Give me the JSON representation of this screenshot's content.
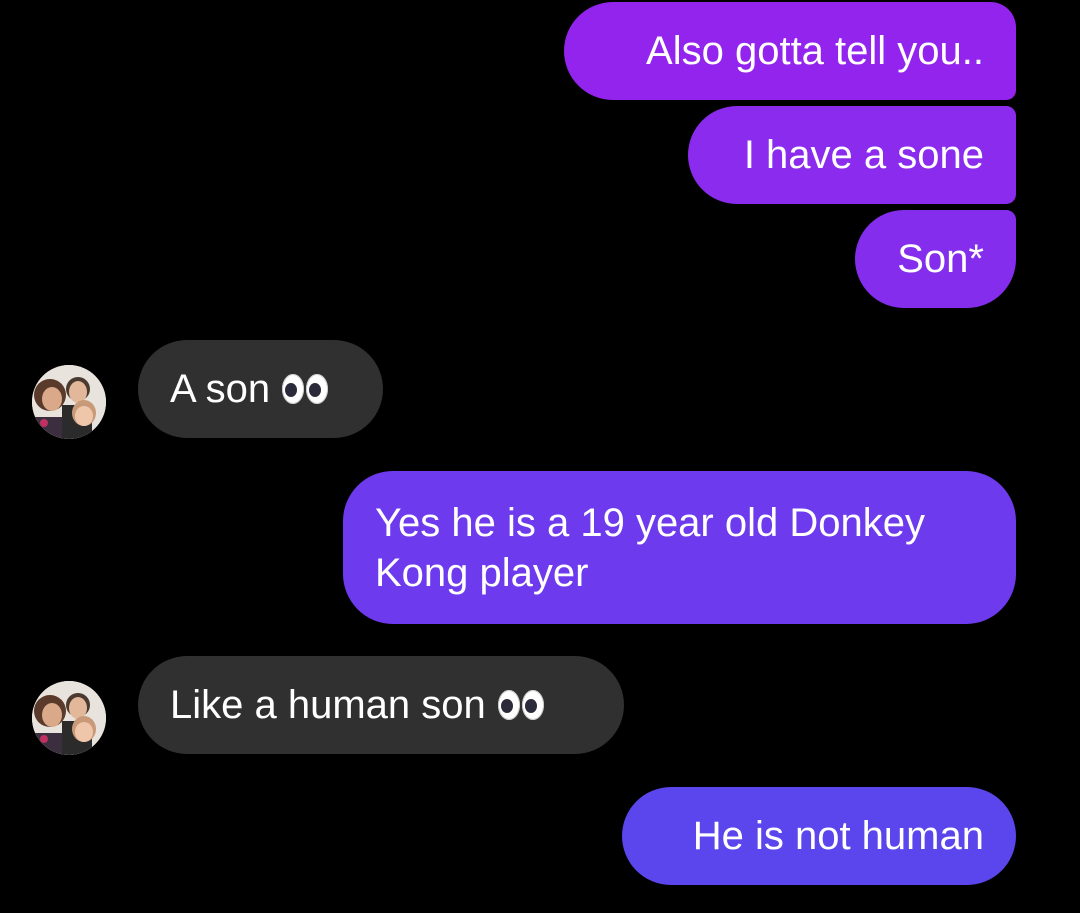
{
  "conversation": {
    "messages": [
      {
        "from": "me",
        "text": "Also gotta tell you.."
      },
      {
        "from": "me",
        "text": "I have a sone"
      },
      {
        "from": "me",
        "text": "Son*"
      },
      {
        "from": "them",
        "text": "A son",
        "emoji": "eyes-emoji"
      },
      {
        "from": "me",
        "text": "Yes he is a 19 year old Donkey Kong player"
      },
      {
        "from": "them",
        "text": "Like a human son",
        "emoji": "eyes-emoji"
      },
      {
        "from": "me",
        "text": "He is not human"
      }
    ]
  },
  "colors": {
    "background": "#000000",
    "incoming_bubble": "#303030",
    "outgoing_gradient_top": "#9224ee",
    "outgoing_gradient_bottom": "#5a46ec"
  }
}
